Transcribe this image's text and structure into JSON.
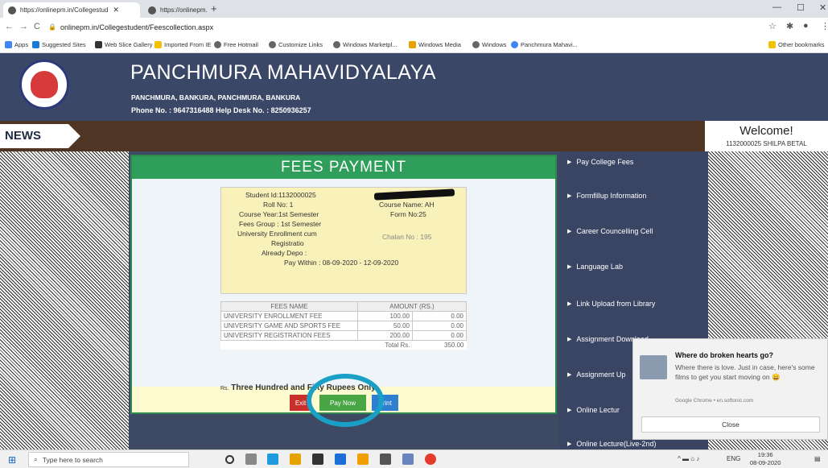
{
  "browser": {
    "tabs": [
      {
        "title": "https://onlinepm.in/Collegestud",
        "active": true
      },
      {
        "title": "https://onlinepm.in/Admission/",
        "active": false
      }
    ],
    "url": "onlinepm.in/Collegestudent/Feescollection.aspx",
    "bookmarks": [
      "Apps",
      "Suggested Sites",
      "Web Slice Gallery",
      "Imported From IE",
      "Free Hotmail",
      "Customize Links",
      "Windows Marketpl...",
      "Windows Media",
      "Windows",
      "Panchmura Mahavi...",
      "Other bookmarks"
    ]
  },
  "site": {
    "name": "PANCHMURA MAHAVIDYALAYA",
    "address": "PANCHMURA, BANKURA, PANCHMURA, BANKURA",
    "phone": "Phone No. : 9647316488    Help Desk No. : 8250936257",
    "news_label": "NEWS",
    "welcome_title": "Welcome!",
    "welcome_user": "1132000025 SHILPA BETAL"
  },
  "fees": {
    "title": "FEES PAYMENT",
    "student_id": "Student Id:1132000025",
    "roll_no": "Roll No: 1",
    "course_name": "Course Name: AH",
    "course_year": "Course Year:1st Semester",
    "form_no": "Form No:25",
    "fees_group": "Fees Group : 1st Semester",
    "university_line1": "University Enrollment cum",
    "university_line2": "Registratio",
    "chalan_no": "Chalan No : 195",
    "already_depo": "Already Depo :",
    "pay_within": "Pay Within : 08-09-2020 - 12-09-2020",
    "table_headers": [
      "FEES NAME",
      "AMOUNT (RS.)"
    ],
    "rows": [
      {
        "name": "UNIVERSITY ENROLLMENT FEE",
        "amount": "100.00",
        "paid": "0.00"
      },
      {
        "name": "UNIVERSITY GAME AND SPORTS FEE",
        "amount": "50.00",
        "paid": "0.00"
      },
      {
        "name": "UNIVERSITY REGISTRATION FEES",
        "amount": "200.00",
        "paid": "0.00"
      }
    ],
    "total_label": "Total Rs.",
    "total_value": "350.00",
    "words_prefix": "Rs.",
    "words": "Three Hundred and Fifty Rupees Only",
    "btn_exit": "Exit",
    "btn_pay": "Pay Now",
    "btn_print": "Print"
  },
  "menu": [
    "Pay College Fees",
    "Formfillup Information",
    "Career Councelling Cell",
    "Language Lab",
    "Link Upload from Library",
    "Assignment Download",
    "Assignment Up",
    "Online Lectur",
    "Online Lecture(Live-2nd)"
  ],
  "notification": {
    "title": "Where do broken hearts go?",
    "body": "Where there is love. Just in case, here's some films to get you start moving on",
    "source": "Google Chrome • en.softonic.com",
    "close": "Close"
  },
  "taskbar": {
    "search_placeholder": "Type here to search",
    "lang": "ENG",
    "time": "19:36",
    "date": "08-09-2020"
  },
  "colors": {
    "header_bg": "#3b4766",
    "fees_title_green": "#2e9e5a",
    "pay_button": "#49a644",
    "exit_button": "#c9302c",
    "print_button": "#2f7fd1",
    "highlight_circle": "#1aa0c6"
  }
}
